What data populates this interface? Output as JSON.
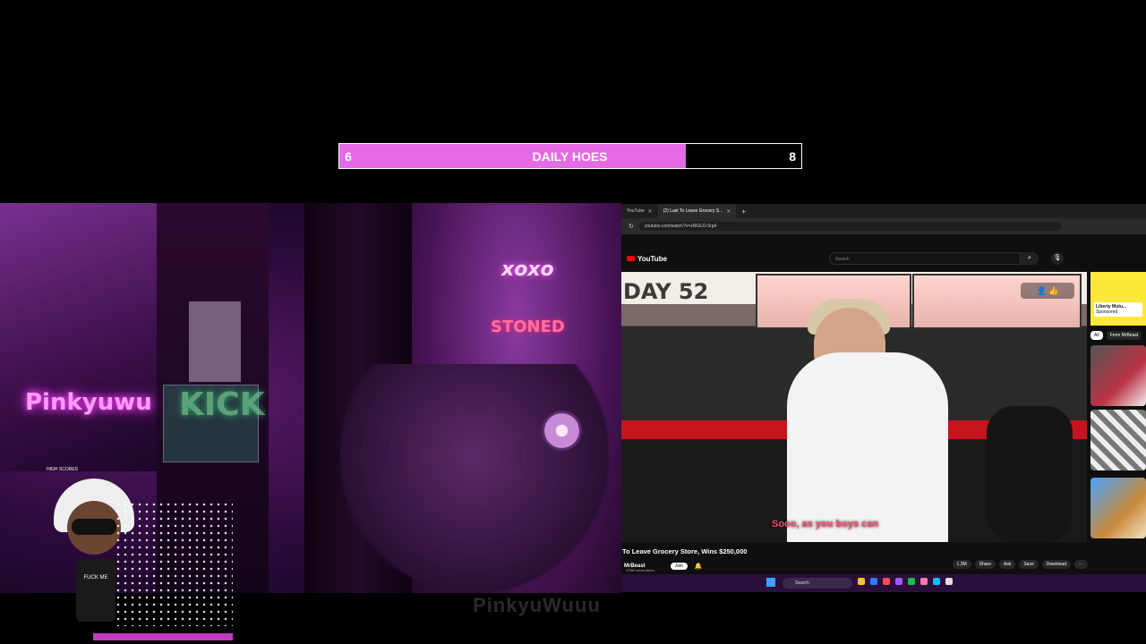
{
  "goal": {
    "left_count": "6",
    "title": "DAILY HOES",
    "right_count": "8",
    "progress": 0.75,
    "fill_color": "#e66ae6"
  },
  "stream_overlay": {
    "neon_pinky": "Pinkyuwu",
    "neon_xoxo": "xoxo",
    "neon_stoned": "STONED",
    "neon_kick": "KICK",
    "high_scores": "HIGH SCORES",
    "avatar_shirt": "FUCK ME",
    "watermark": "PinkyuWuuu"
  },
  "browser": {
    "tabs": [
      {
        "label": "YouTube",
        "active": false
      },
      {
        "label": "(2) Last To Leave Grocery S...",
        "active": true
      }
    ],
    "url": "youtube.com/watch?v=zRlGLD-5rg4",
    "yt_logo_text": "YouTube",
    "search_placeholder": "Search",
    "video": {
      "overlay_text": "DAY 52",
      "subtitle": "Sooo, as you boys can",
      "title": "To Leave Grocery Store, Wins $250,000",
      "channel": "MrBeast",
      "subs": "478M subscribers",
      "join_label": "Join",
      "actions": {
        "likes": "1.2M",
        "share": "Share",
        "ask": "Ask",
        "save": "Save",
        "download": "Download",
        "more": "⋯"
      }
    },
    "sidebar": {
      "ad_title": "Liberty Mutu...",
      "ad_sub": "Sponsored",
      "chips": [
        "All",
        "From MrBeast"
      ]
    },
    "taskbar": {
      "search_placeholder": "Search"
    }
  },
  "icons": {
    "search": "search-icon",
    "mic": "mic-icon",
    "bell": "bell-icon",
    "close": "close-icon",
    "plus": "plus-icon",
    "reload": "reload-icon"
  }
}
